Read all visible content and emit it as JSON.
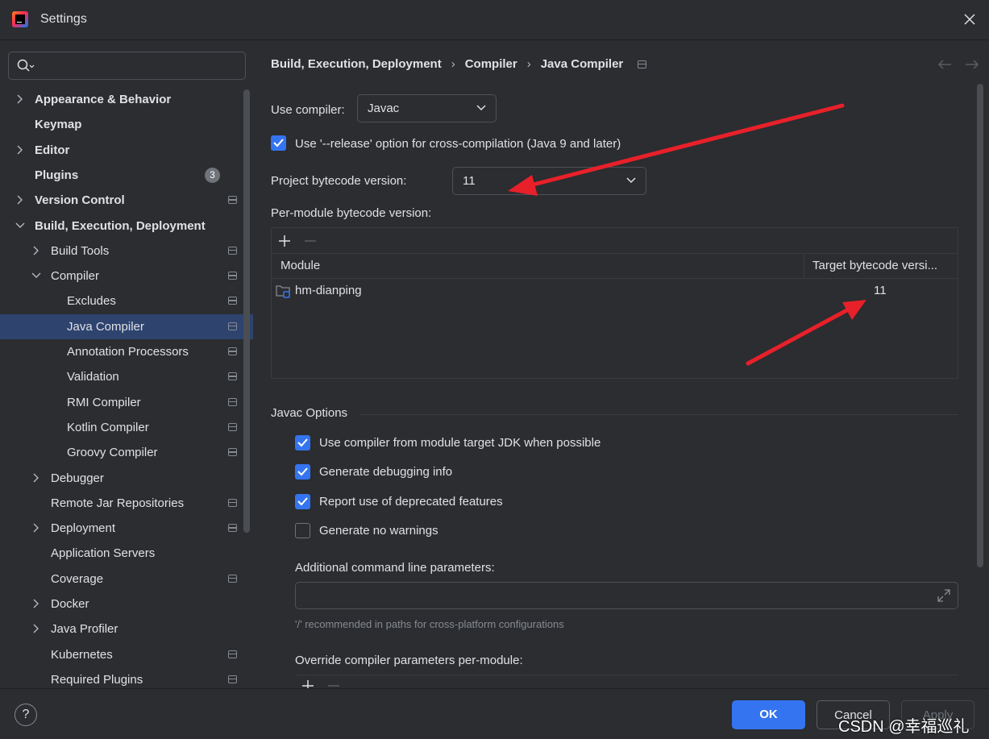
{
  "window": {
    "title": "Settings"
  },
  "search": {
    "placeholder": ""
  },
  "sidebar": {
    "items": [
      {
        "label": "Appearance & Behavior",
        "bold": true,
        "level": 0,
        "chevron": "right",
        "badge": "",
        "project": false
      },
      {
        "label": "Keymap",
        "bold": true,
        "level": 0,
        "chevron": "",
        "badge": "",
        "project": false
      },
      {
        "label": "Editor",
        "bold": true,
        "level": 0,
        "chevron": "right",
        "badge": "",
        "project": false
      },
      {
        "label": "Plugins",
        "bold": true,
        "level": 0,
        "chevron": "",
        "badge": "3",
        "project": false
      },
      {
        "label": "Version Control",
        "bold": true,
        "level": 0,
        "chevron": "right",
        "badge": "",
        "project": true
      },
      {
        "label": "Build, Execution, Deployment",
        "bold": true,
        "level": 0,
        "chevron": "down",
        "badge": "",
        "project": false
      },
      {
        "label": "Build Tools",
        "bold": false,
        "level": 1,
        "chevron": "right",
        "badge": "",
        "project": true
      },
      {
        "label": "Compiler",
        "bold": false,
        "level": 1,
        "chevron": "down",
        "badge": "",
        "project": true
      },
      {
        "label": "Excludes",
        "bold": false,
        "level": 2,
        "chevron": "",
        "badge": "",
        "project": true
      },
      {
        "label": "Java Compiler",
        "bold": false,
        "level": 2,
        "chevron": "",
        "badge": "",
        "project": true,
        "selected": true
      },
      {
        "label": "Annotation Processors",
        "bold": false,
        "level": 2,
        "chevron": "",
        "badge": "",
        "project": true
      },
      {
        "label": "Validation",
        "bold": false,
        "level": 2,
        "chevron": "",
        "badge": "",
        "project": true
      },
      {
        "label": "RMI Compiler",
        "bold": false,
        "level": 2,
        "chevron": "",
        "badge": "",
        "project": true
      },
      {
        "label": "Kotlin Compiler",
        "bold": false,
        "level": 2,
        "chevron": "",
        "badge": "",
        "project": true
      },
      {
        "label": "Groovy Compiler",
        "bold": false,
        "level": 2,
        "chevron": "",
        "badge": "",
        "project": true
      },
      {
        "label": "Debugger",
        "bold": false,
        "level": 1,
        "chevron": "right",
        "badge": "",
        "project": false
      },
      {
        "label": "Remote Jar Repositories",
        "bold": false,
        "level": 1,
        "chevron": "",
        "badge": "",
        "project": true
      },
      {
        "label": "Deployment",
        "bold": false,
        "level": 1,
        "chevron": "right",
        "badge": "",
        "project": true
      },
      {
        "label": "Application Servers",
        "bold": false,
        "level": 1,
        "chevron": "",
        "badge": "",
        "project": false
      },
      {
        "label": "Coverage",
        "bold": false,
        "level": 1,
        "chevron": "",
        "badge": "",
        "project": true
      },
      {
        "label": "Docker",
        "bold": false,
        "level": 1,
        "chevron": "right",
        "badge": "",
        "project": false
      },
      {
        "label": "Java Profiler",
        "bold": false,
        "level": 1,
        "chevron": "right",
        "badge": "",
        "project": false
      },
      {
        "label": "Kubernetes",
        "bold": false,
        "level": 1,
        "chevron": "",
        "badge": "",
        "project": true
      },
      {
        "label": "Required Plugins",
        "bold": false,
        "level": 1,
        "chevron": "",
        "badge": "",
        "project": true
      }
    ]
  },
  "breadcrumb": {
    "items": [
      "Build, Execution, Deployment",
      "Compiler",
      "Java Compiler"
    ],
    "separator": "›"
  },
  "compiler": {
    "use_compiler_label": "Use compiler:",
    "use_compiler_value": "Javac",
    "release_option_label": "Use '--release' option for cross-compilation (Java 9 and later)",
    "release_option_checked": true,
    "project_bytecode_label": "Project bytecode version:",
    "project_bytecode_value": "11",
    "per_module_label": "Per-module bytecode version:"
  },
  "module_table": {
    "columns": [
      "Module",
      "Target bytecode versi..."
    ],
    "rows": [
      {
        "module": "hm-dianping",
        "target": "11"
      }
    ]
  },
  "javac_options": {
    "title": "Javac Options",
    "checkboxes": [
      {
        "label": "Use compiler from module target JDK when possible",
        "checked": true
      },
      {
        "label": "Generate debugging info",
        "checked": true
      },
      {
        "label": "Report use of deprecated features",
        "checked": true
      },
      {
        "label": "Generate no warnings",
        "checked": false
      }
    ],
    "additional_params_label": "Additional command line parameters:",
    "additional_params_value": "",
    "hint": "'/' recommended in paths for cross-platform configurations",
    "override_label": "Override compiler parameters per-module:"
  },
  "footer": {
    "help": "?",
    "ok": "OK",
    "cancel": "Cancel",
    "apply": "Apply"
  },
  "watermark": "CSDN @幸福巡礼",
  "colors": {
    "accent": "#3574f0",
    "selection": "#2e436e",
    "annotation_arrow": "#e8202a"
  }
}
